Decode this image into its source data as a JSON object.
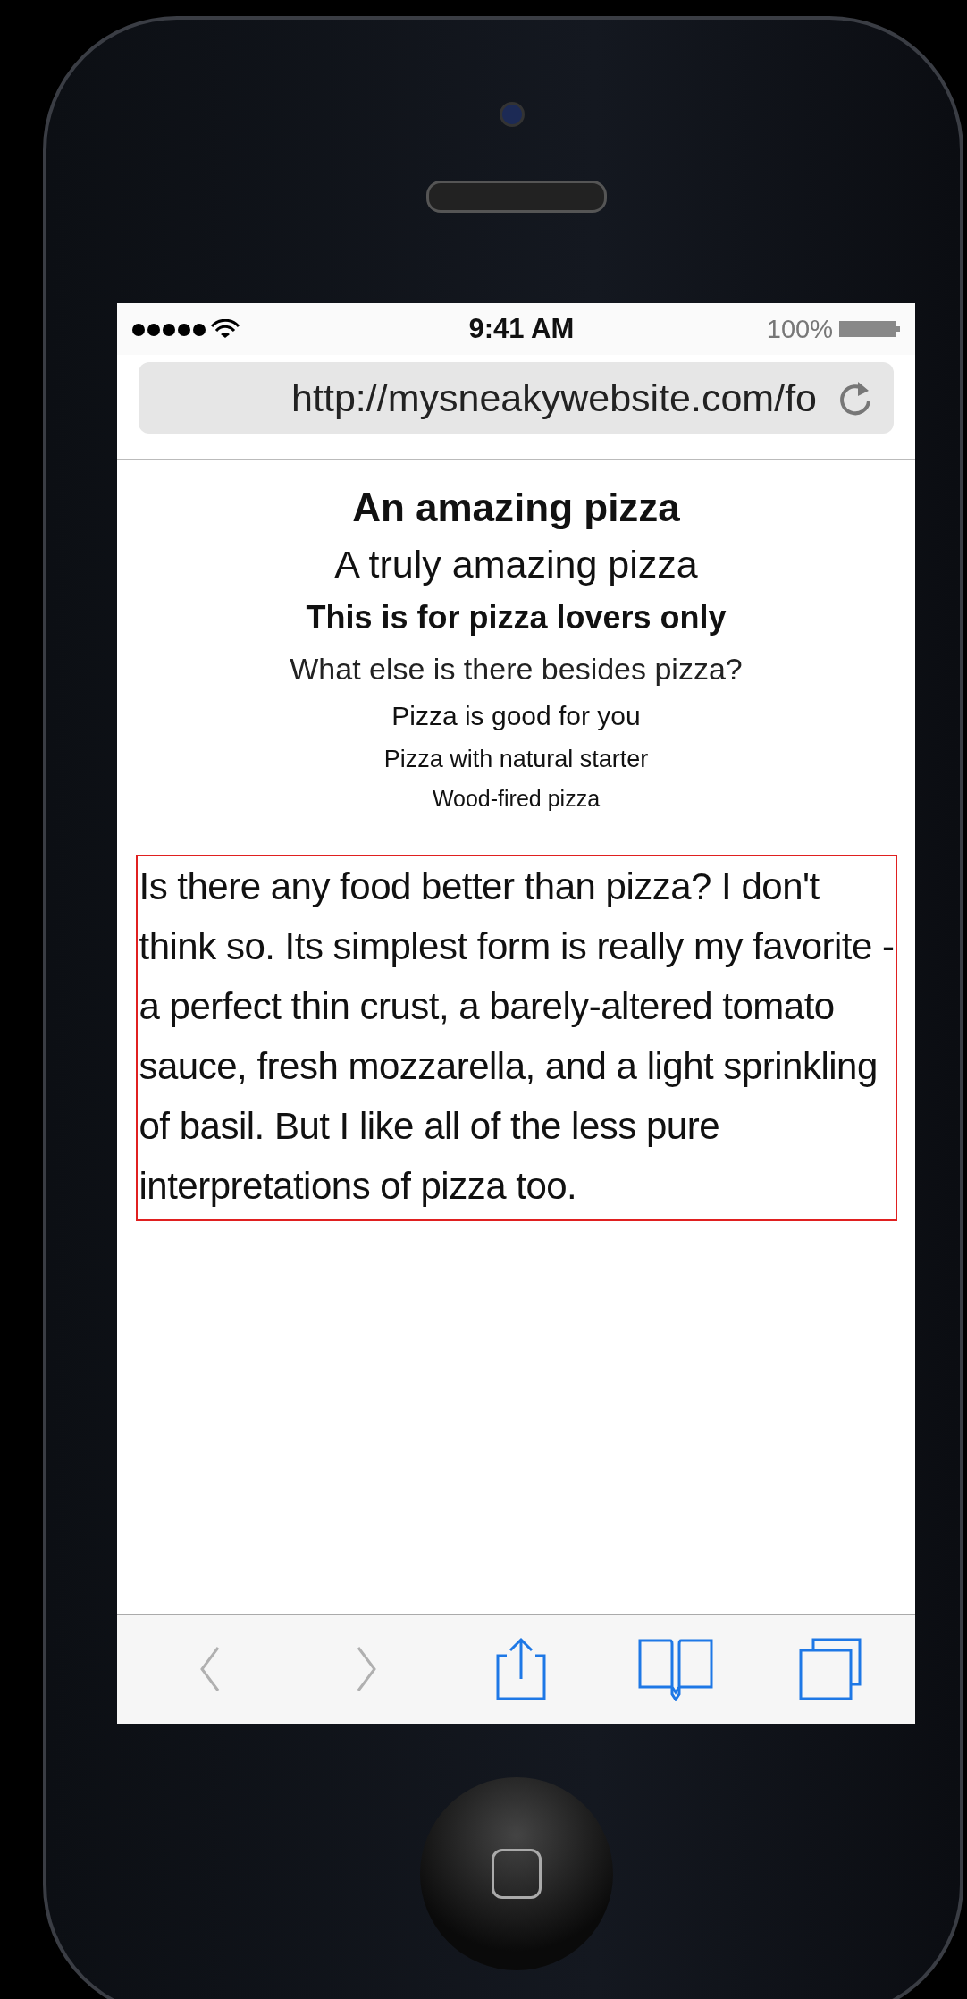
{
  "status_bar": {
    "time": "9:41 AM",
    "battery": "100%"
  },
  "address_bar": {
    "url": "http://mysneakywebsite.com/fo"
  },
  "headings": [
    {
      "kind": "h1",
      "text": "An amazing pizza"
    },
    {
      "kind": "h2",
      "text": "A truly amazing pizza"
    },
    {
      "kind": "h3",
      "text": "This is for pizza lovers only"
    },
    {
      "kind": "h4",
      "text": "What else is there besides pizza?"
    },
    {
      "kind": "h5",
      "text": "Pizza is good for you"
    },
    {
      "kind": "h6",
      "text": "Pizza with natural starter"
    },
    {
      "kind": "h7",
      "text": "Wood-fired pizza"
    }
  ],
  "paragraph": "Is there any food better than pizza? I don't think so. Its simplest form is really my favorite - a perfect thin crust, a barely-altered tomato sauce, fresh mozzarella, and a light sprinkling of basil. But I like all of the less pure interpretations of pizza too.",
  "toolbar": [
    {
      "kind": "back",
      "disabled": true
    },
    {
      "kind": "forward",
      "disabled": true
    },
    {
      "kind": "share",
      "disabled": false
    },
    {
      "kind": "bookmarks",
      "disabled": false
    },
    {
      "kind": "tabs",
      "disabled": false
    }
  ]
}
